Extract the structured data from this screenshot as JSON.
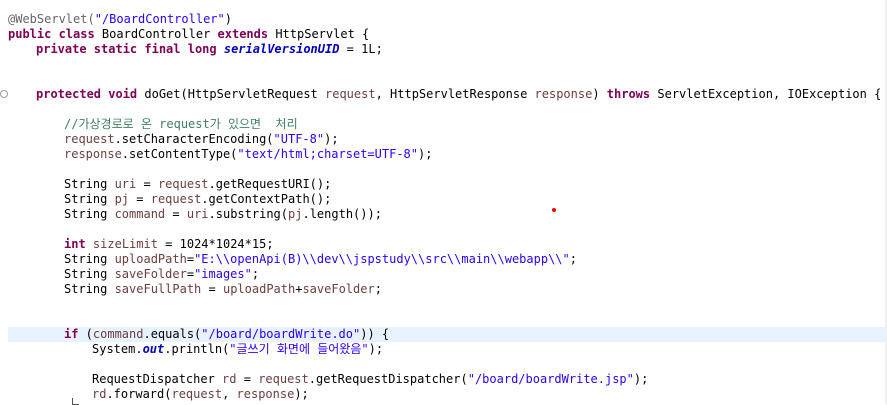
{
  "lines": {
    "l1": {
      "ann": "@WebServlet(",
      "s": "\"/BoardController\"",
      "t": ")"
    },
    "l2": {
      "k1": "public class",
      "t1": " BoardController ",
      "k2": "extends",
      "t2": " HttpServlet {"
    },
    "l3": {
      "k": "private static final long",
      "f": "serialVersionUID",
      "t": " = 1L;"
    },
    "l5": {
      "k1": "protected void",
      "t1": " doGet(HttpServletRequest ",
      "p1": "request",
      "t2": ", HttpServletResponse ",
      "p2": "response",
      "t3": ") ",
      "k2": "throws",
      "t4": " ServletException, IOException {"
    },
    "l7": {
      "c": "//가상경로로 온 request가 있으면  처리"
    },
    "l8": {
      "p": "request",
      "t1": ".setCharacterEncoding(",
      "s": "\"UTF-8\"",
      "t2": ");"
    },
    "l9": {
      "p": "response",
      "t1": ".setContentType(",
      "s": "\"text/html;charset=UTF-8\"",
      "t2": ");"
    },
    "l11": {
      "t1": "String ",
      "v": "uri",
      "t2": " = ",
      "p": "request",
      "t3": ".getRequestURI();"
    },
    "l12": {
      "t1": "String ",
      "v": "pj",
      "t2": " = ",
      "p": "request",
      "t3": ".getContextPath();"
    },
    "l13": {
      "t1": "String ",
      "v": "command",
      "t2": " = ",
      "v2": "uri",
      "t3": ".substring(",
      "v3": "pj",
      "t4": ".length());"
    },
    "l15": {
      "k": "int",
      "t1": " ",
      "v": "sizeLimit",
      "t2": " = 1024*1024*15;"
    },
    "l16": {
      "t1": "String ",
      "v": "uploadPath",
      "t2": "=",
      "s": "\"E:\\\\openApi(B)\\\\dev\\\\jspstudy\\\\src\\\\main\\\\webapp\\\\\"",
      "t3": ";"
    },
    "l17": {
      "t1": "String ",
      "v": "saveFolder",
      "t2": "=",
      "s": "\"images\"",
      "t3": ";"
    },
    "l18": {
      "t1": "String ",
      "v": "saveFullPath",
      "t2": " = ",
      "v2": "uploadPath",
      "t3": "+",
      "v3": "saveFolder",
      "t4": ";"
    },
    "l21": {
      "k": "if",
      "t1": " (",
      "v": "command",
      "t2": ".equals(",
      "s": "\"/board/boardWrite.do\"",
      "t3": ")) {"
    },
    "l22": {
      "t1": "System.",
      "f": "out",
      "t2": ".println(",
      "s": "\"글쓰기 화면에 들어왔음\"",
      "t3": ");"
    },
    "l24": {
      "t1": "RequestDispatcher ",
      "v": "rd",
      "t2": " = ",
      "p": "request",
      "t3": ".getRequestDispatcher(",
      "s": "\"/board/boardWrite.jsp\"",
      "t4": ");"
    },
    "l25": {
      "v": "rd",
      "t1": ".forward(",
      "p1": "request",
      "t2": ", ",
      "p2": "response",
      "t3": ");"
    }
  }
}
